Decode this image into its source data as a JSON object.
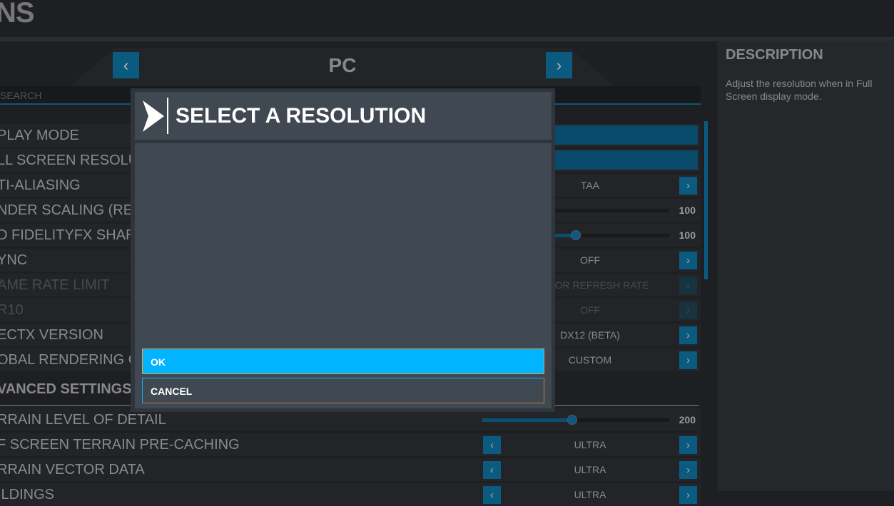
{
  "header": {
    "title": "NS"
  },
  "platform": {
    "title": "PC",
    "prev_icon": "chevron-left-icon",
    "next_icon": "chevron-right-icon"
  },
  "search": {
    "placeholder": "SEARCH"
  },
  "rows": [
    {
      "label": "PLAY MODE",
      "type": "bar"
    },
    {
      "label": "LL SCREEN RESOLUT",
      "type": "bar"
    },
    {
      "label": "TI-ALIASING",
      "type": "option",
      "value": "TAA"
    },
    {
      "label": "NDER SCALING (REN",
      "type": "slider",
      "value": "100",
      "fill": 0.04
    },
    {
      "label": "D FIDELITYFX SHAR",
      "type": "slider",
      "value": "100",
      "fill": 0.5
    },
    {
      "label": "YNC",
      "type": "option",
      "value": "OFF"
    },
    {
      "label": "AME RATE LIMIT",
      "type": "option",
      "value": "ONITOR REFRESH RATE",
      "disabled": true
    },
    {
      "label": "R10",
      "type": "option",
      "value": "OFF",
      "disabled": true
    },
    {
      "label": "ECTX VERSION",
      "type": "option",
      "value": "DX12 (BETA)"
    },
    {
      "label": "OBAL RENDERING Q",
      "type": "option",
      "value": "CUSTOM"
    }
  ],
  "advanced": {
    "title": "VANCED SETTINGS",
    "rows": [
      {
        "label": "RRAIN LEVEL OF DETAIL",
        "type": "slider",
        "value": "200",
        "fill": 0.48
      },
      {
        "label": "F SCREEN TERRAIN PRE-CACHING",
        "type": "option2",
        "value": "ULTRA"
      },
      {
        "label": "RRAIN VECTOR DATA",
        "type": "option2",
        "value": "ULTRA"
      },
      {
        "label": "ILDINGS",
        "type": "option2",
        "value": "ULTRA"
      }
    ]
  },
  "description": {
    "title": "DESCRIPTION",
    "text": "Adjust the resolution when in Full Screen display mode."
  },
  "modal": {
    "title": "SELECT A RESOLUTION",
    "ok": "OK",
    "cancel": "CANCEL"
  },
  "colors": {
    "accent": "#00b4ff",
    "dark_blue": "#0b5a80",
    "modal_bg": "#404852"
  }
}
